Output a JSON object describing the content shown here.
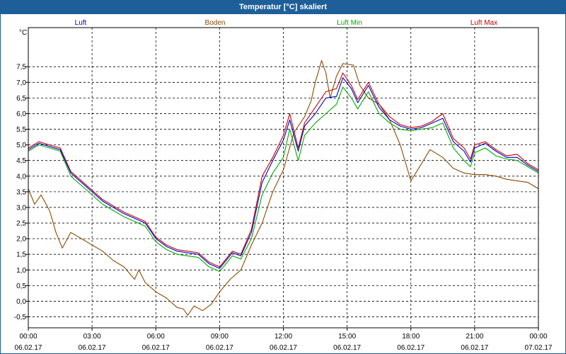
{
  "window": {
    "title": "Temperatur [°C] skaliert"
  },
  "colors": {
    "luft": "#0000cc",
    "boden": "#8b4a00",
    "luft_min": "#00aa00",
    "luft_max": "#cc0000",
    "title_bg": "#1e5f99",
    "grid": "#000000"
  },
  "chart_data": {
    "type": "line",
    "title": "Temperatur [°C] skaliert",
    "ylabel": "°C",
    "ylim": [
      -0.85,
      8.75
    ],
    "y_ticks": [
      "-0,5",
      "0,0",
      "0,5",
      "1,0",
      "1,5",
      "2,0",
      "2,5",
      "3,0",
      "3,5",
      "4,0",
      "4,5",
      "5,0",
      "5,5",
      "6,0",
      "6,5",
      "7,0",
      "7,5"
    ],
    "y_tick_values": [
      -0.5,
      0,
      0.5,
      1,
      1.5,
      2,
      2.5,
      3,
      3.5,
      4,
      4.5,
      5,
      5.5,
      6,
      6.5,
      7,
      7.5
    ],
    "xlim": [
      0,
      24
    ],
    "x_ticks": [
      {
        "time": "00:00",
        "date": "06.02.17"
      },
      {
        "time": "03:00",
        "date": "06.02.17"
      },
      {
        "time": "06:00",
        "date": "06.02.17"
      },
      {
        "time": "09:00",
        "date": "06.02.17"
      },
      {
        "time": "12:00",
        "date": "06.02.17"
      },
      {
        "time": "15:00",
        "date": "06.02.17"
      },
      {
        "time": "18:00",
        "date": "06.02.17"
      },
      {
        "time": "21:00",
        "date": "06.02.17"
      },
      {
        "time": "00:00",
        "date": "07.02.17"
      }
    ],
    "x_tick_values": [
      0,
      3,
      6,
      9,
      12,
      15,
      18,
      21,
      24
    ],
    "grid": true,
    "legend_position": "top",
    "series": [
      {
        "name": "Luft",
        "color": "#0000cc",
        "points": [
          [
            0,
            4.85
          ],
          [
            0.5,
            5.05
          ],
          [
            1,
            4.95
          ],
          [
            1.5,
            4.85
          ],
          [
            2,
            4.1
          ],
          [
            2.5,
            3.8
          ],
          [
            3,
            3.5
          ],
          [
            3.5,
            3.2
          ],
          [
            4,
            3.0
          ],
          [
            4.5,
            2.8
          ],
          [
            5,
            2.65
          ],
          [
            5.5,
            2.5
          ],
          [
            6,
            2.0
          ],
          [
            6.5,
            1.75
          ],
          [
            7,
            1.6
          ],
          [
            7.5,
            1.55
          ],
          [
            8,
            1.5
          ],
          [
            8.5,
            1.2
          ],
          [
            9,
            1.05
          ],
          [
            9.3,
            1.3
          ],
          [
            9.6,
            1.55
          ],
          [
            10,
            1.45
          ],
          [
            10.5,
            2.2
          ],
          [
            11,
            3.8
          ],
          [
            11.5,
            4.5
          ],
          [
            12,
            5.15
          ],
          [
            12.3,
            5.8
          ],
          [
            12.7,
            4.8
          ],
          [
            13,
            5.6
          ],
          [
            13.5,
            6.0
          ],
          [
            14,
            6.5
          ],
          [
            14.5,
            6.55
          ],
          [
            14.8,
            7.15
          ],
          [
            15.2,
            6.8
          ],
          [
            15.5,
            6.35
          ],
          [
            16,
            6.9
          ],
          [
            16.5,
            6.2
          ],
          [
            17,
            5.8
          ],
          [
            17.5,
            5.6
          ],
          [
            18,
            5.5
          ],
          [
            18.5,
            5.55
          ],
          [
            19,
            5.7
          ],
          [
            19.5,
            5.85
          ],
          [
            20,
            5.1
          ],
          [
            20.5,
            4.8
          ],
          [
            20.8,
            4.45
          ],
          [
            21,
            4.9
          ],
          [
            21.5,
            5.05
          ],
          [
            22,
            4.8
          ],
          [
            22.5,
            4.6
          ],
          [
            23,
            4.6
          ],
          [
            23.5,
            4.35
          ],
          [
            24,
            4.15
          ]
        ]
      },
      {
        "name": "Boden",
        "color": "#8b4a00",
        "points": [
          [
            0,
            3.6
          ],
          [
            0.3,
            3.1
          ],
          [
            0.6,
            3.4
          ],
          [
            1,
            2.9
          ],
          [
            1.3,
            2.2
          ],
          [
            1.6,
            1.7
          ],
          [
            2,
            2.2
          ],
          [
            2.5,
            2.0
          ],
          [
            3,
            1.8
          ],
          [
            3.5,
            1.6
          ],
          [
            4,
            1.3
          ],
          [
            4.5,
            1.1
          ],
          [
            5,
            0.7
          ],
          [
            5.2,
            1.0
          ],
          [
            5.5,
            0.6
          ],
          [
            6,
            0.3
          ],
          [
            6.5,
            0.1
          ],
          [
            7,
            -0.2
          ],
          [
            7.3,
            -0.25
          ],
          [
            7.5,
            -0.45
          ],
          [
            7.8,
            -0.15
          ],
          [
            8.2,
            -0.3
          ],
          [
            8.6,
            -0.1
          ],
          [
            9,
            0.3
          ],
          [
            9.5,
            0.7
          ],
          [
            10,
            1.0
          ],
          [
            10.5,
            1.8
          ],
          [
            11,
            2.5
          ],
          [
            11.5,
            3.5
          ],
          [
            12,
            4.2
          ],
          [
            12.5,
            5.4
          ],
          [
            13,
            5.9
          ],
          [
            13.3,
            6.4
          ],
          [
            13.5,
            7.0
          ],
          [
            13.8,
            7.7
          ],
          [
            14,
            7.3
          ],
          [
            14.2,
            6.5
          ],
          [
            14.5,
            7.2
          ],
          [
            14.8,
            7.6
          ],
          [
            15.3,
            7.55
          ],
          [
            15.6,
            6.9
          ],
          [
            16,
            6.5
          ],
          [
            16.5,
            6.3
          ],
          [
            17,
            5.8
          ],
          [
            17.5,
            5.0
          ],
          [
            18,
            3.85
          ],
          [
            18.5,
            4.4
          ],
          [
            18.9,
            4.85
          ],
          [
            19.5,
            4.6
          ],
          [
            20,
            4.25
          ],
          [
            20.5,
            4.1
          ],
          [
            21,
            4.05
          ],
          [
            21.5,
            4.05
          ],
          [
            22,
            4.0
          ],
          [
            22.5,
            3.9
          ],
          [
            23,
            3.85
          ],
          [
            23.5,
            3.8
          ],
          [
            24,
            3.6
          ]
        ]
      },
      {
        "name": "Luft Min",
        "color": "#00aa00",
        "points": [
          [
            0,
            4.8
          ],
          [
            0.5,
            5.0
          ],
          [
            1,
            4.9
          ],
          [
            1.5,
            4.8
          ],
          [
            2,
            4.0
          ],
          [
            2.5,
            3.7
          ],
          [
            3,
            3.4
          ],
          [
            3.5,
            3.1
          ],
          [
            4,
            2.9
          ],
          [
            4.5,
            2.7
          ],
          [
            5,
            2.55
          ],
          [
            5.5,
            2.4
          ],
          [
            6,
            1.9
          ],
          [
            6.5,
            1.65
          ],
          [
            7,
            1.5
          ],
          [
            7.5,
            1.45
          ],
          [
            8,
            1.4
          ],
          [
            8.5,
            1.1
          ],
          [
            9,
            0.95
          ],
          [
            9.3,
            1.2
          ],
          [
            9.6,
            1.45
          ],
          [
            10,
            1.35
          ],
          [
            10.5,
            2.0
          ],
          [
            11,
            3.4
          ],
          [
            11.5,
            4.1
          ],
          [
            12,
            4.6
          ],
          [
            12.3,
            5.5
          ],
          [
            12.7,
            4.5
          ],
          [
            13,
            5.3
          ],
          [
            13.5,
            5.7
          ],
          [
            14,
            6.0
          ],
          [
            14.5,
            6.3
          ],
          [
            14.8,
            6.85
          ],
          [
            15.2,
            6.5
          ],
          [
            15.5,
            6.15
          ],
          [
            16,
            6.7
          ],
          [
            16.5,
            6.0
          ],
          [
            17,
            5.7
          ],
          [
            17.5,
            5.5
          ],
          [
            18,
            5.45
          ],
          [
            18.5,
            5.5
          ],
          [
            19,
            5.55
          ],
          [
            19.5,
            5.7
          ],
          [
            20,
            4.9
          ],
          [
            20.5,
            4.5
          ],
          [
            20.8,
            4.3
          ],
          [
            21,
            4.75
          ],
          [
            21.5,
            4.9
          ],
          [
            22,
            4.65
          ],
          [
            22.5,
            4.55
          ],
          [
            23,
            4.5
          ],
          [
            23.5,
            4.3
          ],
          [
            24,
            4.1
          ]
        ]
      },
      {
        "name": "Luft Max",
        "color": "#cc0000",
        "points": [
          [
            0,
            4.9
          ],
          [
            0.5,
            5.1
          ],
          [
            1,
            5.0
          ],
          [
            1.5,
            4.9
          ],
          [
            2,
            4.15
          ],
          [
            2.5,
            3.85
          ],
          [
            3,
            3.55
          ],
          [
            3.5,
            3.25
          ],
          [
            4,
            3.05
          ],
          [
            4.5,
            2.85
          ],
          [
            5,
            2.7
          ],
          [
            5.5,
            2.55
          ],
          [
            6,
            2.05
          ],
          [
            6.5,
            1.8
          ],
          [
            7,
            1.65
          ],
          [
            7.5,
            1.6
          ],
          [
            8,
            1.55
          ],
          [
            8.5,
            1.25
          ],
          [
            9,
            1.1
          ],
          [
            9.3,
            1.35
          ],
          [
            9.6,
            1.6
          ],
          [
            10,
            1.5
          ],
          [
            10.5,
            2.3
          ],
          [
            11,
            4.0
          ],
          [
            11.5,
            4.6
          ],
          [
            12,
            5.3
          ],
          [
            12.3,
            6.0
          ],
          [
            12.7,
            4.9
          ],
          [
            13,
            5.7
          ],
          [
            13.5,
            6.2
          ],
          [
            14,
            6.7
          ],
          [
            14.5,
            6.8
          ],
          [
            14.8,
            7.3
          ],
          [
            15.2,
            6.9
          ],
          [
            15.5,
            6.45
          ],
          [
            16,
            7.0
          ],
          [
            16.5,
            6.3
          ],
          [
            17,
            5.9
          ],
          [
            17.5,
            5.65
          ],
          [
            18,
            5.55
          ],
          [
            18.5,
            5.6
          ],
          [
            19,
            5.75
          ],
          [
            19.5,
            6.0
          ],
          [
            20,
            5.2
          ],
          [
            20.5,
            4.9
          ],
          [
            20.8,
            4.55
          ],
          [
            21,
            5.0
          ],
          [
            21.5,
            5.1
          ],
          [
            22,
            4.85
          ],
          [
            22.5,
            4.65
          ],
          [
            23,
            4.7
          ],
          [
            23.5,
            4.4
          ],
          [
            24,
            4.2
          ]
        ]
      }
    ]
  }
}
